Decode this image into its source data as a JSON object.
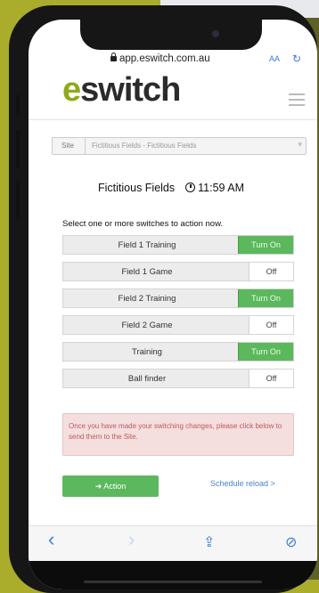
{
  "browser": {
    "url": "app.eswitch.com.au",
    "text_size_label": "AA",
    "reload_icon": "reload-icon"
  },
  "brand": {
    "first": "e",
    "rest": "switch"
  },
  "site": {
    "label": "Site",
    "value": "Fictitious Fields - Fictitious Fields"
  },
  "venue": {
    "name": "Fictitious Fields",
    "time": "11:59 AM"
  },
  "instruction": "Select one or more switches to action now.",
  "switches": [
    {
      "name": "Field 1 Training",
      "state": "Turn On"
    },
    {
      "name": "Field 1 Game",
      "state": "Off"
    },
    {
      "name": "Field 2 Training",
      "state": "Turn On"
    },
    {
      "name": "Field 2 Game",
      "state": "Off"
    },
    {
      "name": "Training",
      "state": "Turn On"
    },
    {
      "name": "Ball finder",
      "state": "Off"
    }
  ],
  "alert": "Once you have made your switching changes, please click below to send them to the Site.",
  "action": {
    "label": "Action",
    "icon": "arrow-right-icon"
  },
  "schedule_link": "Schedule reload >",
  "toolbar": {
    "back": "‹",
    "forward": "›",
    "share": "⇪",
    "compass": "⊘"
  },
  "colors": {
    "accent_green": "#5cb85c",
    "brand_green": "#8fa91a",
    "link_blue": "#4a86c8"
  }
}
